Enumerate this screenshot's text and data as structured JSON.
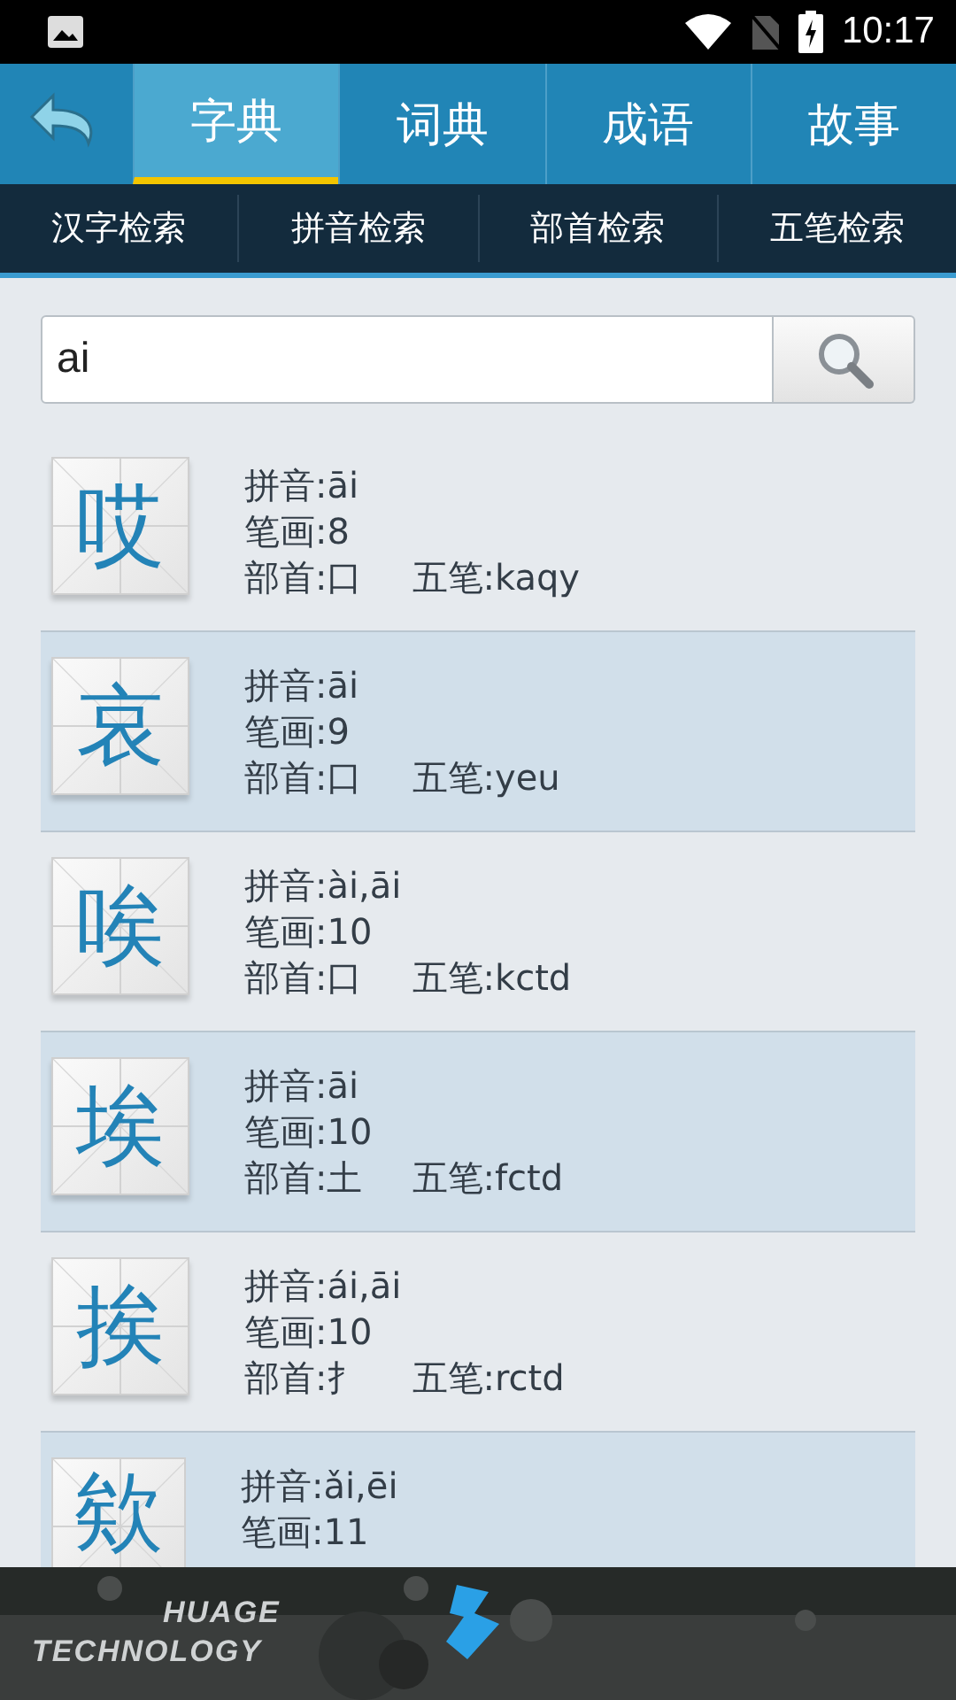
{
  "status_bar": {
    "time": "10:17"
  },
  "tabs": [
    {
      "label": "字典",
      "selected": true
    },
    {
      "label": "词典",
      "selected": false
    },
    {
      "label": "成语",
      "selected": false
    },
    {
      "label": "故事",
      "selected": false
    }
  ],
  "sub_tabs": [
    "汉字检索",
    "拼音检索",
    "部首检索",
    "五笔检索"
  ],
  "search": {
    "value": "ai"
  },
  "results": [
    {
      "character": "哎",
      "pinyin": "拼音:āi",
      "strokes": "笔画:8",
      "radical": "部首:口",
      "wubi": "五笔:kaqy"
    },
    {
      "character": "哀",
      "pinyin": "拼音:āi",
      "strokes": "笔画:9",
      "radical": "部首:口",
      "wubi": "五笔:yeu"
    },
    {
      "character": "唉",
      "pinyin": "拼音:ài,āi",
      "strokes": "笔画:10",
      "radical": "部首:口",
      "wubi": "五笔:kctd"
    },
    {
      "character": "埃",
      "pinyin": "拼音:āi",
      "strokes": "笔画:10",
      "radical": "部首:土",
      "wubi": "五笔:fctd"
    },
    {
      "character": "挨",
      "pinyin": "拼音:ái,āi",
      "strokes": "笔画:10",
      "radical": "部首:扌",
      "wubi": "五笔:rctd"
    },
    {
      "character": "欸",
      "pinyin": "拼音:ǎi,ēi",
      "strokes": "笔画:11"
    }
  ],
  "banner": {
    "line_1": "HUAGE",
    "line_2": "TECHNOLOGY"
  }
}
